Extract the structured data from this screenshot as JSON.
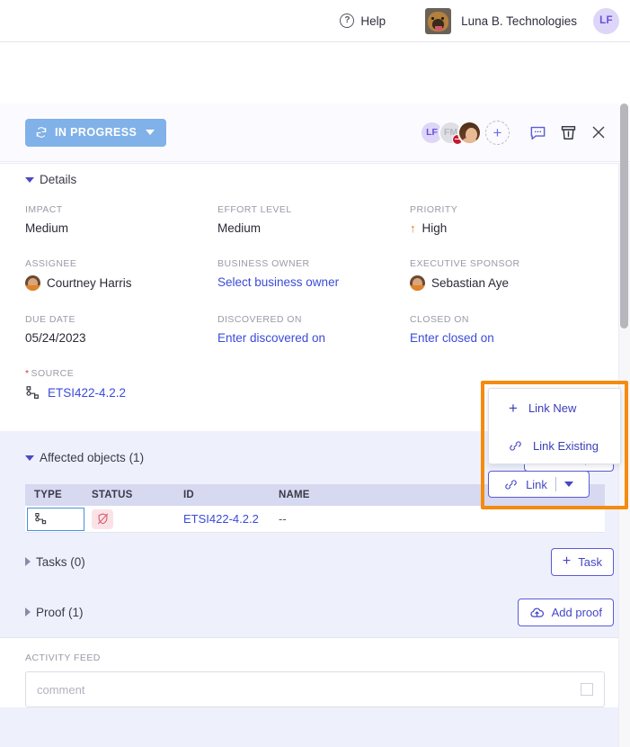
{
  "topbar": {
    "help_label": "Help",
    "help_icon": "question-circle-icon",
    "org_name": "Luna B. Technologies",
    "user_initials": "LF"
  },
  "toolbar": {
    "status_label": "IN PROGRESS",
    "status_icon": "sync-arrows-icon",
    "status_color": "#80b1e8",
    "avatars": [
      {
        "initials": "LF",
        "type": "initials"
      },
      {
        "initials": "FM",
        "type": "initials-disabled"
      },
      {
        "initials": "",
        "type": "photo"
      }
    ],
    "add_member_label": "+",
    "comment_icon": "comment-bubble-icon",
    "archive_icon": "archive-box-icon",
    "close_icon": "close-x-icon"
  },
  "details": {
    "section_title": "Details",
    "fields": [
      {
        "label": "IMPACT",
        "value": "Medium",
        "kind": "text"
      },
      {
        "label": "EFFORT LEVEL",
        "value": "Medium",
        "kind": "text"
      },
      {
        "label": "PRIORITY",
        "value": "High",
        "kind": "priority"
      },
      {
        "label": "ASSIGNEE",
        "value": "Courtney Harris",
        "kind": "person"
      },
      {
        "label": "BUSINESS OWNER",
        "value": "Select business owner",
        "kind": "placeholder-link"
      },
      {
        "label": "EXECUTIVE SPONSOR",
        "value": "Sebastian Aye",
        "kind": "person"
      },
      {
        "label": "DUE DATE",
        "value": "05/24/2023",
        "kind": "text"
      },
      {
        "label": "DISCOVERED ON",
        "value": "Enter discovered on",
        "kind": "placeholder-link"
      },
      {
        "label": "CLOSED ON",
        "value": "Enter closed on",
        "kind": "placeholder-link"
      }
    ],
    "source": {
      "label": "SOURCE",
      "required_marker": "*",
      "value": "ETSI422-4.2.2",
      "icon": "node-tree-icon"
    }
  },
  "affected_objects": {
    "title": "Affected objects (1)",
    "link_button_label": "Link",
    "link_button_icon": "chain-link-icon",
    "columns": [
      "TYPE",
      "STATUS",
      "ID",
      "NAME"
    ],
    "rows": [
      {
        "type_icon": "node-tree-icon",
        "status_icon": "shield-crossed-icon",
        "id": "ETSI422-4.2.2",
        "name": "--"
      }
    ]
  },
  "link_menu": {
    "items": [
      {
        "label": "Link New",
        "icon": "plus-icon"
      },
      {
        "label": "Link Existing",
        "icon": "chain-link-icon"
      }
    ],
    "trigger_label": "Link",
    "trigger_icon": "chain-link-icon",
    "highlight_color": "#f58b0f"
  },
  "tasks": {
    "title": "Tasks (0)",
    "button_label": "Task",
    "button_icon": "plus-icon"
  },
  "proof": {
    "title": "Proof (1)",
    "button_label": "Add proof",
    "button_icon": "cloud-upload-icon"
  },
  "activity_feed": {
    "label": "ACTIVITY FEED",
    "comment_placeholder": "comment"
  }
}
